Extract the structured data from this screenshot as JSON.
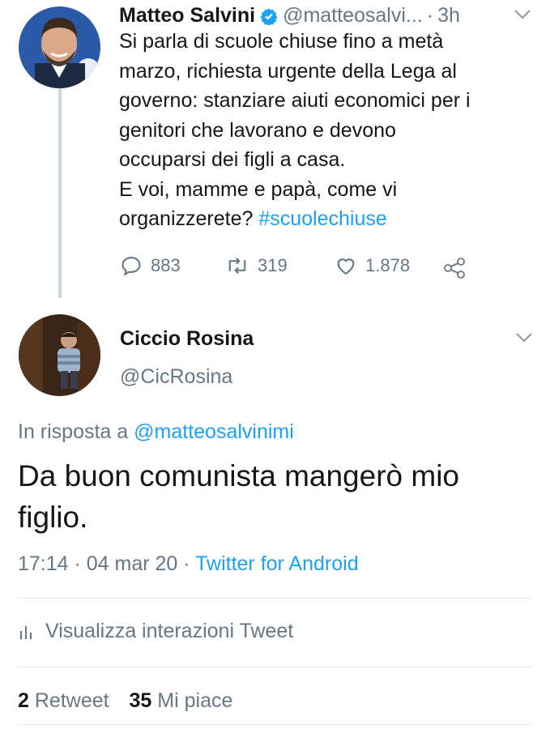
{
  "original_tweet": {
    "author_name": "Matteo Salvini",
    "author_handle": "@matteosalvi...",
    "time_sep": "·",
    "time_ago": "3h",
    "text_lines": [
      "Si parla di scuole chiuse fino a metà",
      "marzo, richiesta urgente della Lega al",
      "governo: stanziare aiuti economici per i",
      "genitori che lavorano e devono",
      "occuparsi dei figli a casa.",
      "E voi, mamme e papà, come vi"
    ],
    "last_line_prefix": "organizzerete?",
    "hashtag": "#scuolechiuse",
    "replies": "883",
    "retweets": "319",
    "likes": "1.878",
    "icons": [
      "verified-badge-icon",
      "chevron-down-icon",
      "reply-icon",
      "retweet-icon",
      "like-icon",
      "share-icon"
    ]
  },
  "reply_tweet": {
    "author_name": "Ciccio Rosina",
    "author_handle": "@CicRosina",
    "in_reply_prefix": "In risposta a",
    "in_reply_handle": "@matteosalvinimi",
    "text_line1": "Da buon comunista mangerò mio",
    "text_line2": "figlio.",
    "timestamp": "17:14 · 04 mar 20",
    "ts_sep": "·",
    "source": "Twitter for Android",
    "analytics_label": "Visualizza interazioni Tweet",
    "retweet_count": "2",
    "retweet_label": "Retweet",
    "like_count": "35",
    "like_label": "Mi piace",
    "icons": [
      "chevron-down-icon",
      "analytics-icon"
    ]
  },
  "colors": {
    "link": "#1da1f2",
    "muted": "#657786",
    "text": "#14171a",
    "divider": "#e1e8ed"
  }
}
